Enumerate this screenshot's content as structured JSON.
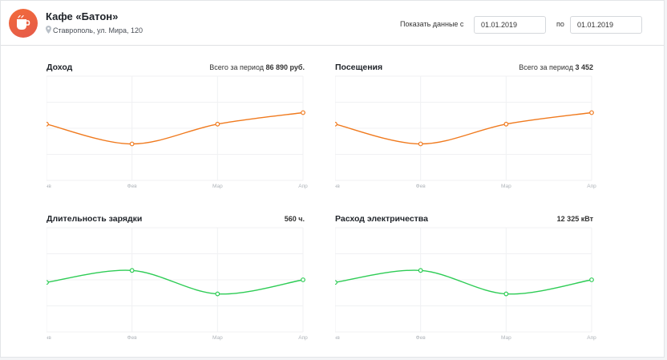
{
  "header": {
    "cafe_name": "Кафе «Батон»",
    "address": "Ставрополь, ул. Мира, 120",
    "filter_label": "Показать данные с",
    "date_from": "01.01.2019",
    "to_label": "по",
    "date_to": "01.01.2019"
  },
  "colors": {
    "orange": "#f07a1e",
    "green": "#2ecc55",
    "logo": "#ee6440"
  },
  "icons": {
    "logo": "coffee-cup-icon",
    "address": "map-pin-icon"
  },
  "cards": [
    {
      "title": "Доход",
      "total_prefix": "Всего за период",
      "total_value": "86 890 руб."
    },
    {
      "title": "Посещения",
      "total_prefix": "Всего за период",
      "total_value": "3 452"
    },
    {
      "title": "Длительность зарядки",
      "total_prefix": "",
      "total_value": "560 ч."
    },
    {
      "title": "Расход электричества",
      "total_prefix": "",
      "total_value": "12 325 кВт"
    }
  ],
  "chart_data": [
    {
      "type": "line",
      "title": "Доход",
      "categories": [
        "Янв",
        "Фев",
        "Мар",
        "Апр"
      ],
      "series": [
        {
          "values": [
            58,
            20,
            58,
            80
          ]
        }
      ],
      "ylim": [
        -50,
        150
      ],
      "color": "#f07a1e",
      "grid": true
    },
    {
      "type": "line",
      "title": "Посещения",
      "categories": [
        "Янв",
        "Фев",
        "Мар",
        "Апр"
      ],
      "series": [
        {
          "values": [
            58,
            20,
            58,
            80
          ]
        }
      ],
      "ylim": [
        -50,
        150
      ],
      "color": "#f07a1e",
      "grid": true
    },
    {
      "type": "line",
      "title": "Длительность зарядки",
      "categories": [
        "Янв",
        "Фев",
        "Мар",
        "Апр"
      ],
      "series": [
        {
          "values": [
            45,
            68,
            23,
            50
          ]
        }
      ],
      "ylim": [
        -50,
        150
      ],
      "color": "#2ecc55",
      "grid": true
    },
    {
      "type": "line",
      "title": "Расход электричества",
      "categories": [
        "Янв",
        "Фев",
        "Мар",
        "Апр"
      ],
      "series": [
        {
          "values": [
            45,
            68,
            23,
            50
          ]
        }
      ],
      "ylim": [
        -50,
        150
      ],
      "color": "#2ecc55",
      "grid": true
    }
  ]
}
